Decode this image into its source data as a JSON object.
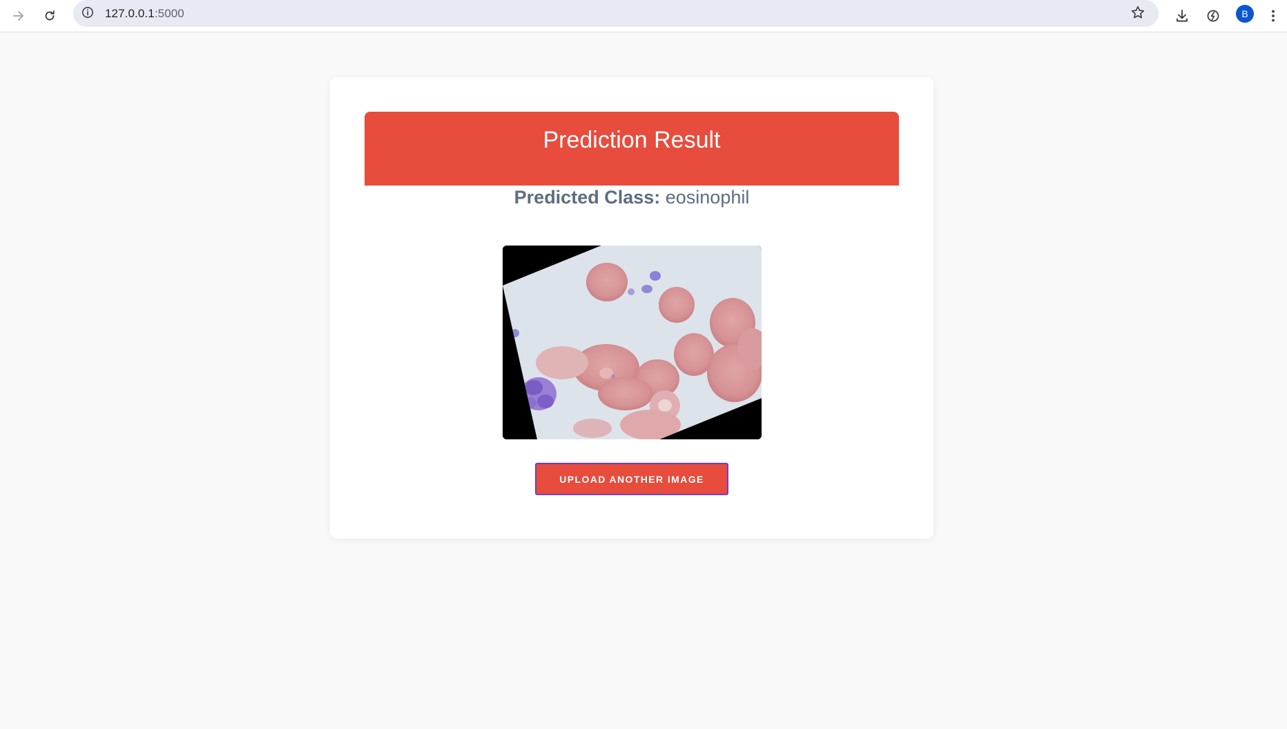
{
  "browser": {
    "url_host": "127.0.0.1",
    "url_port": ":5000",
    "profile_initial": "B"
  },
  "page": {
    "result_title": "Prediction Result",
    "predicted_label": "Predicted Class:",
    "predicted_value": " eosinophil",
    "upload_button_label": "UPLOAD ANOTHER IMAGE"
  },
  "colors": {
    "accent": "#e74c3c",
    "predicted_text": "#5d6d7e",
    "button_border": "#6d3fc8",
    "page_background": "#f9f9f9"
  },
  "icons": {
    "forward": "forward-arrow-icon",
    "reload": "reload-icon",
    "site_info": "info-icon",
    "bookmark": "star-icon",
    "download": "download-icon",
    "performance": "performance-icon",
    "menu": "kebab-menu-icon"
  }
}
